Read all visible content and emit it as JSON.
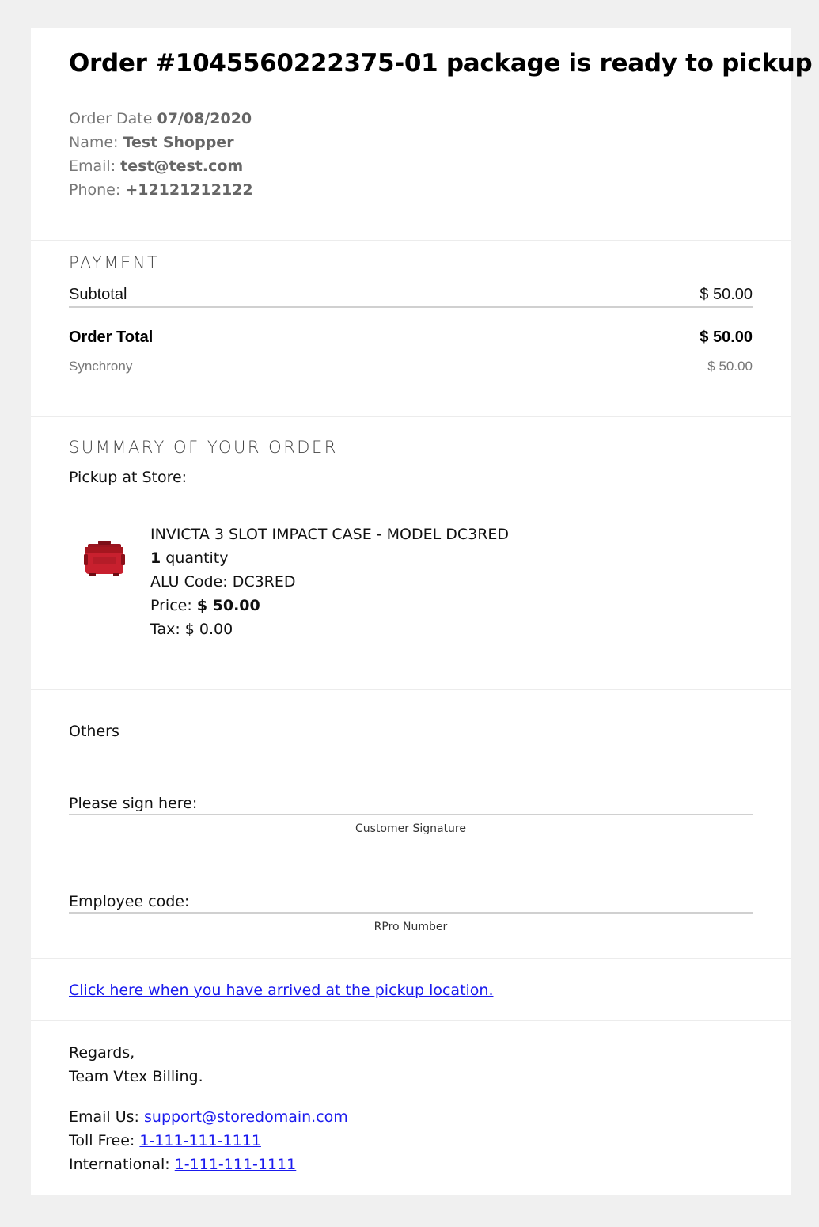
{
  "header": {
    "title": "Order #1045560222375-01 package is ready to pickup",
    "order_date_label": "Order Date",
    "order_date": "07/08/2020",
    "name_label": "Name:",
    "name": "Test Shopper",
    "email_label": "Email:",
    "email": "test@test.com",
    "phone_label": "Phone:",
    "phone": "+12121212122"
  },
  "payment": {
    "heading": "PAYMENT",
    "subtotal_label": "Subtotal",
    "subtotal_value": "$ 50.00",
    "order_total_label": "Order Total",
    "order_total_value": "$ 50.00",
    "method_label": "Synchrony",
    "method_value": "$ 50.00"
  },
  "summary": {
    "heading": "SUMMARY OF YOUR ORDER",
    "pickup_label": "Pickup at Store:",
    "item": {
      "name": "INVICTA 3 SLOT IMPACT CASE - MODEL DC3RED",
      "quantity_number": "1",
      "quantity_label": "quantity",
      "alu_label": "ALU Code:",
      "alu_value": "DC3RED",
      "price_label": "Price:",
      "price_value": "$ 50.00",
      "tax_label": "Tax:",
      "tax_value": "$ 0.00",
      "image_icon": "red-case-icon",
      "image_color": "#c8202e"
    }
  },
  "others": {
    "label": "Others"
  },
  "signature": {
    "prompt": "Please sign here:",
    "caption": "Customer Signature"
  },
  "employee": {
    "prompt": "Employee code:",
    "caption": "RPro Number"
  },
  "arrival": {
    "link_text": "Click here when you have arrived at the pickup location."
  },
  "footer": {
    "regards": "Regards,",
    "team": "Team Vtex Billing.",
    "email_label": "Email Us:",
    "email_link": "support@storedomain.com",
    "tollfree_label": "Toll Free:",
    "tollfree_link": "1-111-111-1111",
    "international_label": "International:",
    "international_link": "1-111-111-1111"
  },
  "colors": {
    "page_bg": "#f0f0f0",
    "card_bg": "#ffffff",
    "link": "#1a1aee"
  }
}
